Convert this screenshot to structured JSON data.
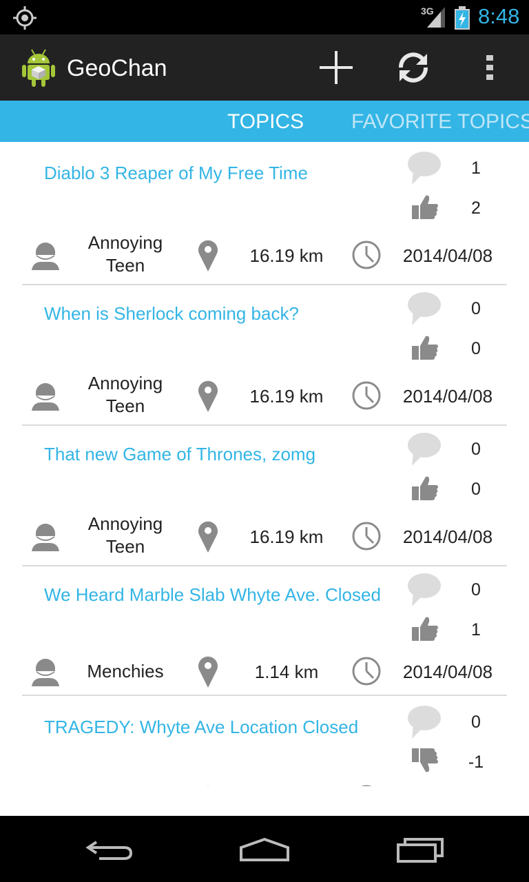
{
  "status_bar": {
    "network_type": "3G",
    "time": "8:48"
  },
  "action_bar": {
    "app_title": "GeoChan",
    "actions": [
      {
        "icon": "plus-icon"
      },
      {
        "icon": "refresh-icon"
      },
      {
        "icon": "overflow-menu-icon"
      }
    ]
  },
  "tabs": [
    {
      "label": "TOPICS",
      "selected": true
    },
    {
      "label": "FAVORITE TOPICS",
      "selected": false
    }
  ],
  "topics": [
    {
      "title": "Diablo 3 Reaper of My Free Time",
      "comments": "1",
      "votes": "2",
      "vote_icon": "thumbs-up-icon",
      "user_line1": "Annoying",
      "user_line2": "Teen",
      "distance": "16.19 km",
      "date": "2014/04/08"
    },
    {
      "title": "When is Sherlock coming back?",
      "comments": "0",
      "votes": "0",
      "vote_icon": "thumbs-up-icon",
      "user_line1": "Annoying",
      "user_line2": "Teen",
      "distance": "16.19 km",
      "date": "2014/04/08"
    },
    {
      "title": "That new Game of Thrones, zomg",
      "comments": "0",
      "votes": "0",
      "vote_icon": "thumbs-up-icon",
      "user_line1": "Annoying",
      "user_line2": "Teen",
      "distance": "16.19 km",
      "date": "2014/04/08"
    },
    {
      "title": "We Heard Marble Slab Whyte Ave. Closed",
      "comments": "0",
      "votes": "1",
      "vote_icon": "thumbs-up-icon",
      "user_line1": "Menchies",
      "user_line2": "",
      "distance": "1.14 km",
      "date": "2014/04/08"
    },
    {
      "title": "TRAGEDY: Whyte Ave Location Closed",
      "comments": "0",
      "votes": "-1",
      "vote_icon": "thumbs-down-icon",
      "user_line1": "",
      "user_line2": "",
      "distance": "",
      "date": ""
    }
  ],
  "colors": {
    "accent": "#33b5e5",
    "action_bar": "#222222",
    "icon_gray": "#8a8a8a"
  }
}
